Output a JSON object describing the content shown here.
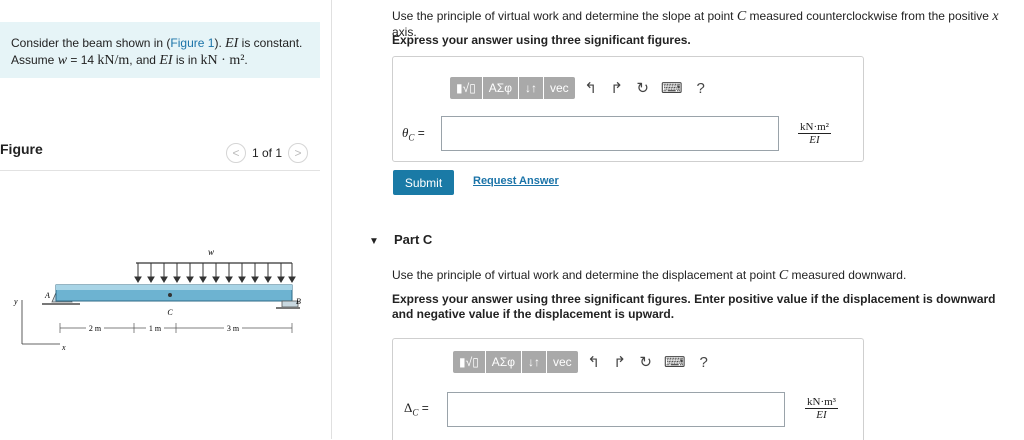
{
  "problem": {
    "text_before": "Consider the beam shown in (",
    "figure_link": "Figure 1",
    "text_after": "). ",
    "ei": "EI",
    "is_constant": " is constant.",
    "line2_a": "Assume ",
    "w_var": "w",
    "line2_b": " = 14 ",
    "w_unit": "kN/m",
    "line2_c": ", and ",
    "ei2": "EI",
    "line2_d": " is in ",
    "ei_unit": "kN · m²",
    "line2_e": "."
  },
  "figure": {
    "heading": "Figure",
    "pager_text": "1 of 1",
    "prev": "<",
    "next": ">",
    "labels": {
      "w": "w",
      "A": "A",
      "B": "B",
      "C": "C",
      "y": "y",
      "x": "x",
      "d1": "2 m",
      "d2": "1 m",
      "d3": "3 m"
    }
  },
  "part_b": {
    "instruction_a": "Use the principle of virtual work and determine the slope at point ",
    "instruction_c": "C",
    "instruction_b": " measured counterclockwise from the positive ",
    "instruction_x": "x",
    "instruction_d": " axis.",
    "express": "Express your answer using three significant figures.",
    "label": "θ",
    "label_sub": "C",
    "eq": " =",
    "unit_num": "kN·m²",
    "unit_den": "EI",
    "submit": "Submit",
    "request": "Request Answer"
  },
  "part_c": {
    "title": "Part C",
    "instruction_a": "Use the principle of virtual work and determine the displacement at point ",
    "instruction_c": "C",
    "instruction_b": " measured downward.",
    "express": "Express your answer using three significant figures. Enter positive value if the displacement is downward and negative value if the displacement is upward.",
    "label": "Δ",
    "label_sub": "C",
    "eq": " =",
    "unit_num": "kN·m³",
    "unit_den": "EI"
  },
  "toolbar": {
    "templates": "▮√▯",
    "greek": "ΑΣφ",
    "arrows": "↓↑",
    "vec": "vec",
    "undo": "↰",
    "redo": "↱",
    "reset": "↻",
    "keyboard": "⌨",
    "help": "?"
  }
}
